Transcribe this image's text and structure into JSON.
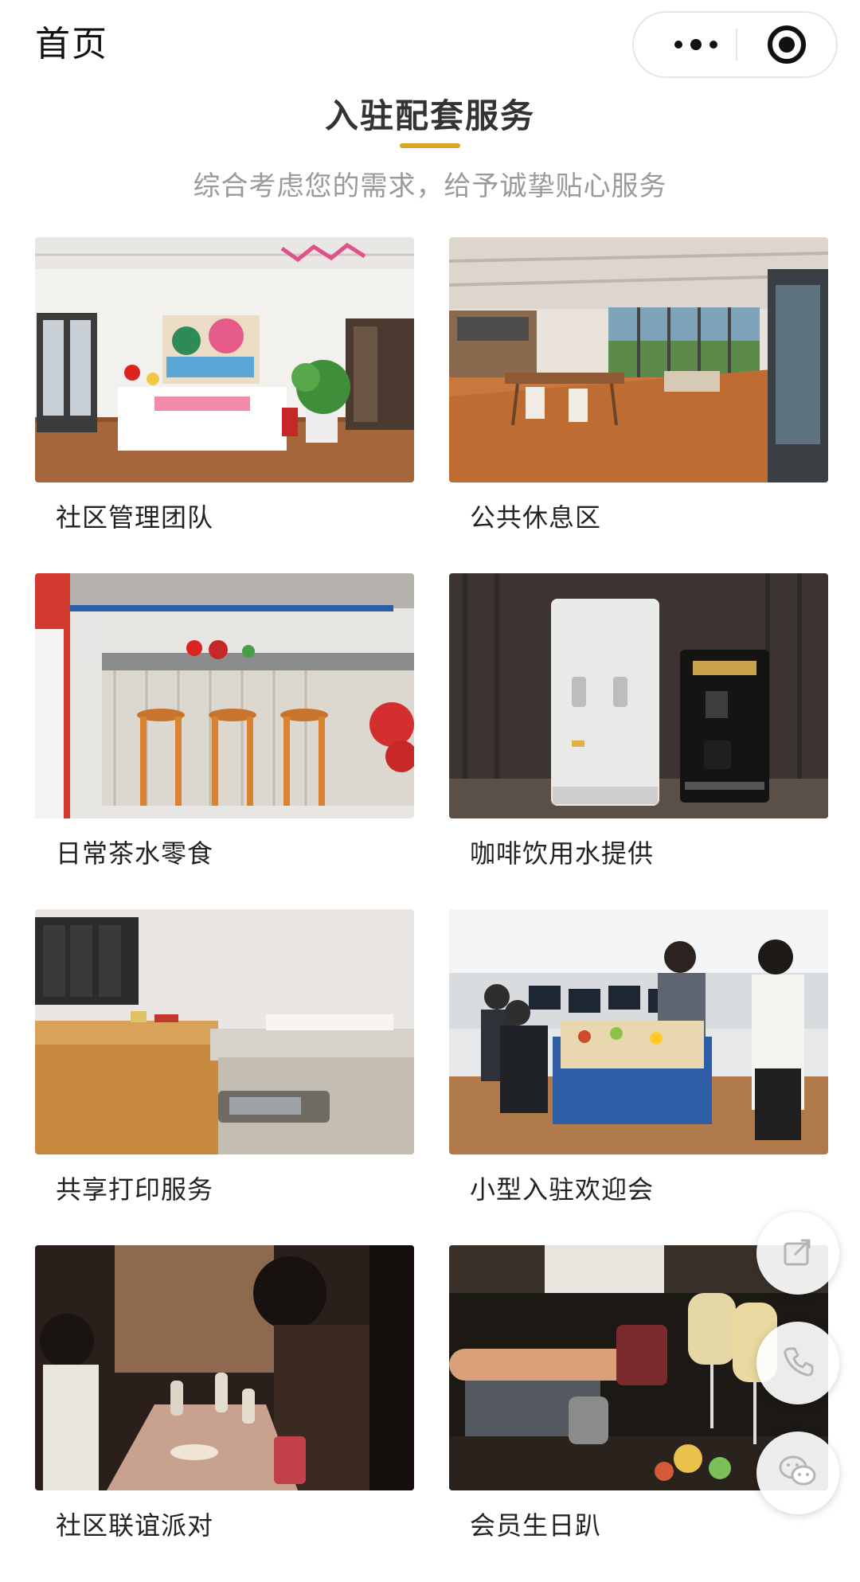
{
  "nav": {
    "title": "首页"
  },
  "section": {
    "title": "入驻配套服务",
    "subtitle": "综合考虑您的需求，给予诚挚贴心服务",
    "accent_color": "#d9a521"
  },
  "services": [
    {
      "label": "社区管理团队",
      "image": "reception-desk-photo"
    },
    {
      "label": "公共休息区",
      "image": "lounge-area-photo"
    },
    {
      "label": "日常茶水零食",
      "image": "pantry-bar-photo"
    },
    {
      "label": "咖啡饮用水提供",
      "image": "coffee-machine-photo"
    },
    {
      "label": "共享打印服务",
      "image": "printer-photo"
    },
    {
      "label": "小型入驻欢迎会",
      "image": "welcome-event-photo"
    },
    {
      "label": "社区联谊派对",
      "image": "party-photo"
    },
    {
      "label": "会员生日趴",
      "image": "birthday-toast-photo"
    }
  ],
  "floating_actions": [
    {
      "icon": "share-icon"
    },
    {
      "icon": "phone-icon"
    },
    {
      "icon": "wechat-icon"
    }
  ]
}
